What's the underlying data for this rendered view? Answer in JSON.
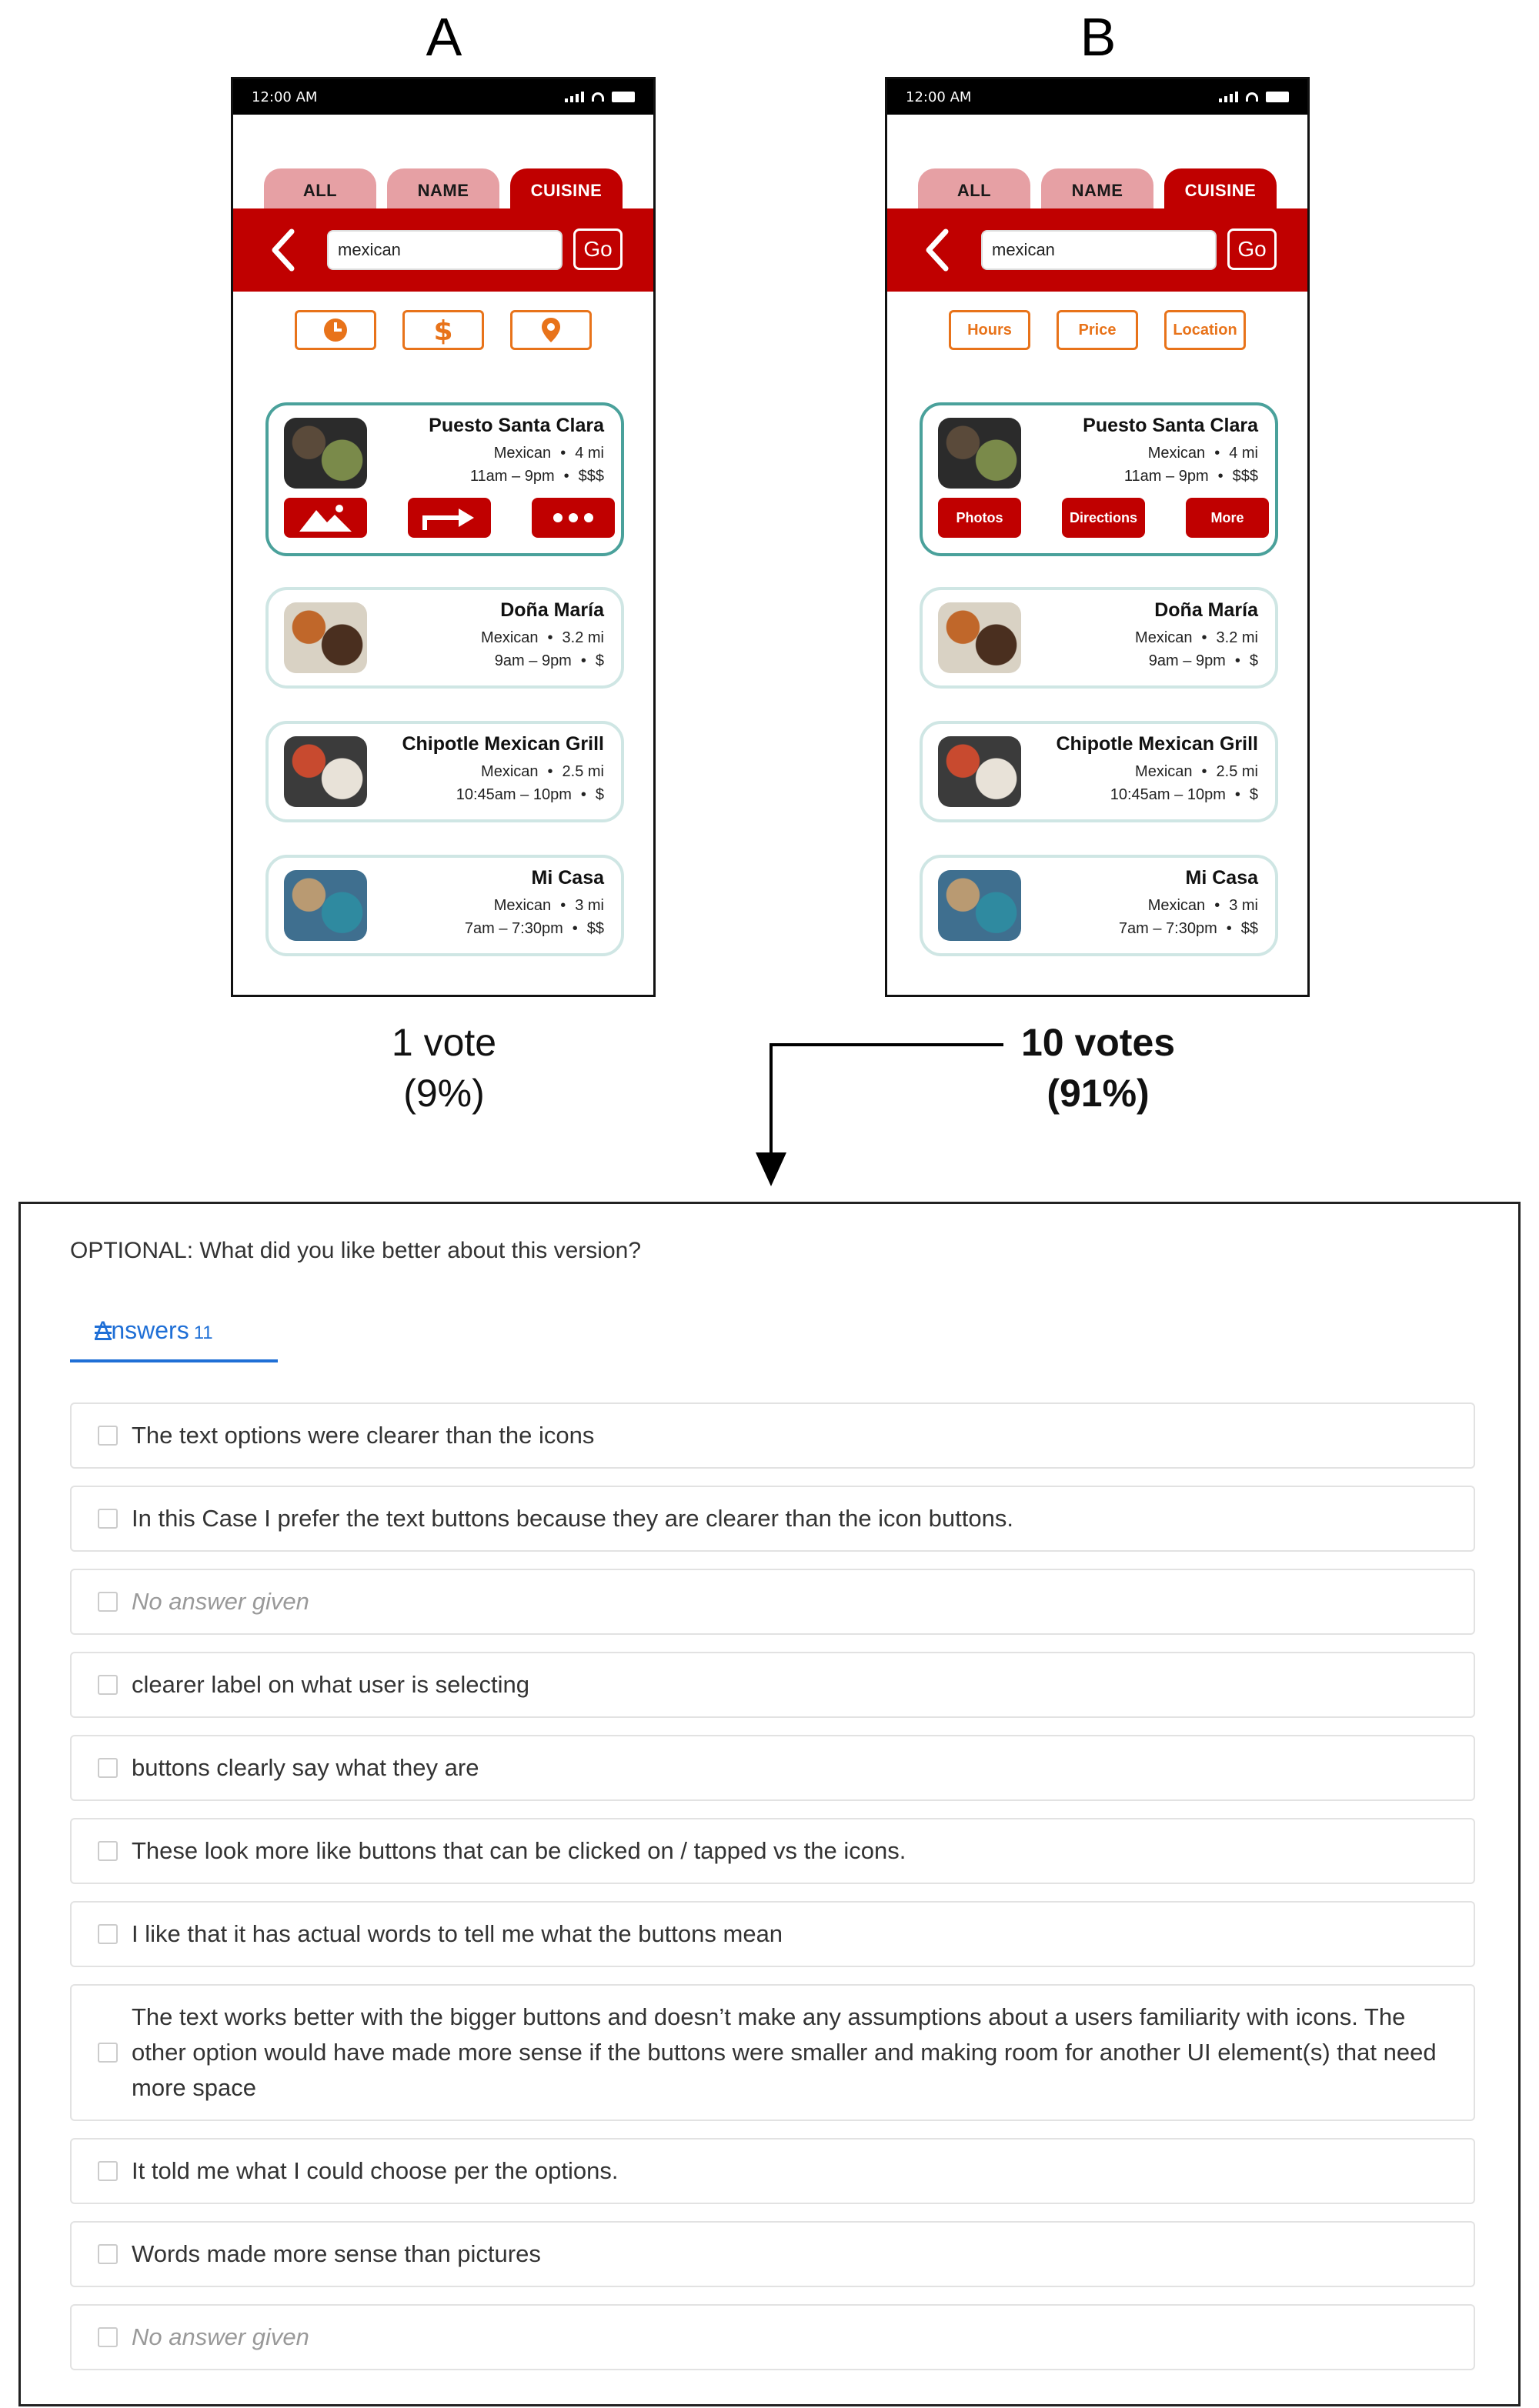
{
  "variants": [
    {
      "label": "A",
      "status_time": "12:00 AM",
      "tabs": [
        "ALL",
        "NAME",
        "CUISINE"
      ],
      "active_tab": "CUISINE",
      "search_value": "mexican",
      "go_label": "Go",
      "filter_style": "icons",
      "filters": [
        {
          "icon": "clock-icon",
          "label": ""
        },
        {
          "icon": "dollar-icon",
          "label": ""
        },
        {
          "icon": "location-pin-icon",
          "label": ""
        }
      ],
      "action_style": "icons",
      "actions": [
        {
          "icon": "photos-icon",
          "label": ""
        },
        {
          "icon": "directions-arrow-icon",
          "label": ""
        },
        {
          "icon": "more-dots-icon",
          "label": ""
        }
      ],
      "vote_count": "1 vote",
      "vote_pct": "(9%)"
    },
    {
      "label": "B",
      "status_time": "12:00 AM",
      "tabs": [
        "ALL",
        "NAME",
        "CUISINE"
      ],
      "active_tab": "CUISINE",
      "search_value": "mexican",
      "go_label": "Go",
      "filter_style": "text",
      "filters": [
        {
          "icon": "",
          "label": "Hours"
        },
        {
          "icon": "",
          "label": "Price"
        },
        {
          "icon": "",
          "label": "Location"
        }
      ],
      "action_style": "text",
      "actions": [
        {
          "icon": "",
          "label": "Photos"
        },
        {
          "icon": "",
          "label": "Directions"
        },
        {
          "icon": "",
          "label": "More"
        }
      ],
      "vote_count": "10 votes",
      "vote_pct": "(91%)"
    }
  ],
  "restaurants": [
    {
      "name": "Puesto Santa Clara",
      "cuisine": "Mexican",
      "distance": "4 mi",
      "hours": "11am – 9pm",
      "price": "$$$",
      "thumb_colors": [
        "#2b2b2b",
        "#5a4a3a",
        "#7a8a4a"
      ]
    },
    {
      "name": "Doña María",
      "cuisine": "Mexican",
      "distance": "3.2 mi",
      "hours": "9am – 9pm",
      "price": "$",
      "thumb_colors": [
        "#d9d2c4",
        "#c0672a",
        "#4a2f1f"
      ]
    },
    {
      "name": "Chipotle Mexican Grill",
      "cuisine": "Mexican",
      "distance": "2.5 mi",
      "hours": "10:45am – 10pm",
      "price": "$",
      "thumb_colors": [
        "#3b3b3b",
        "#c84a2f",
        "#e8e2d8"
      ]
    },
    {
      "name": "Mi Casa",
      "cuisine": "Mexican",
      "distance": "3 mi",
      "hours": "7am – 7:30pm",
      "price": "$$",
      "thumb_colors": [
        "#3f6f8f",
        "#b99a72",
        "#2f8aa0"
      ]
    }
  ],
  "survey": {
    "question": "OPTIONAL: What did you like better about this version?",
    "tab_label": "Answers",
    "tab_count": "11",
    "answers": [
      {
        "text": "The text options were clearer than the icons",
        "empty": false
      },
      {
        "text": "In this Case I prefer the text buttons because they are clearer than the icon buttons.",
        "empty": false
      },
      {
        "text": "No answer given",
        "empty": true
      },
      {
        "text": "clearer label on what user is selecting",
        "empty": false
      },
      {
        "text": "buttons clearly say what they are",
        "empty": false
      },
      {
        "text": "These look more like buttons that can be clicked on / tapped vs the icons.",
        "empty": false
      },
      {
        "text": "I like that it has actual words to tell me what the buttons mean",
        "empty": false
      },
      {
        "text": "The text works better with the bigger buttons and doesn’t make any assumptions about a users familiarity with icons. The other option would have made more sense if the buttons were smaller and making room for another UI element(s) that need more space",
        "empty": false
      },
      {
        "text": "It told me what I could choose per the options.",
        "empty": false
      },
      {
        "text": "Words made more sense than pictures",
        "empty": false
      },
      {
        "text": "No answer given",
        "empty": true
      }
    ]
  },
  "colors": {
    "brand_red": "#c00000",
    "tab_inactive": "#e6a0a4",
    "filter_orange": "#e8731a",
    "card_border": "#cfe6e4",
    "card_selected_border": "#4aa19b",
    "link_blue": "#1f6fd6"
  }
}
